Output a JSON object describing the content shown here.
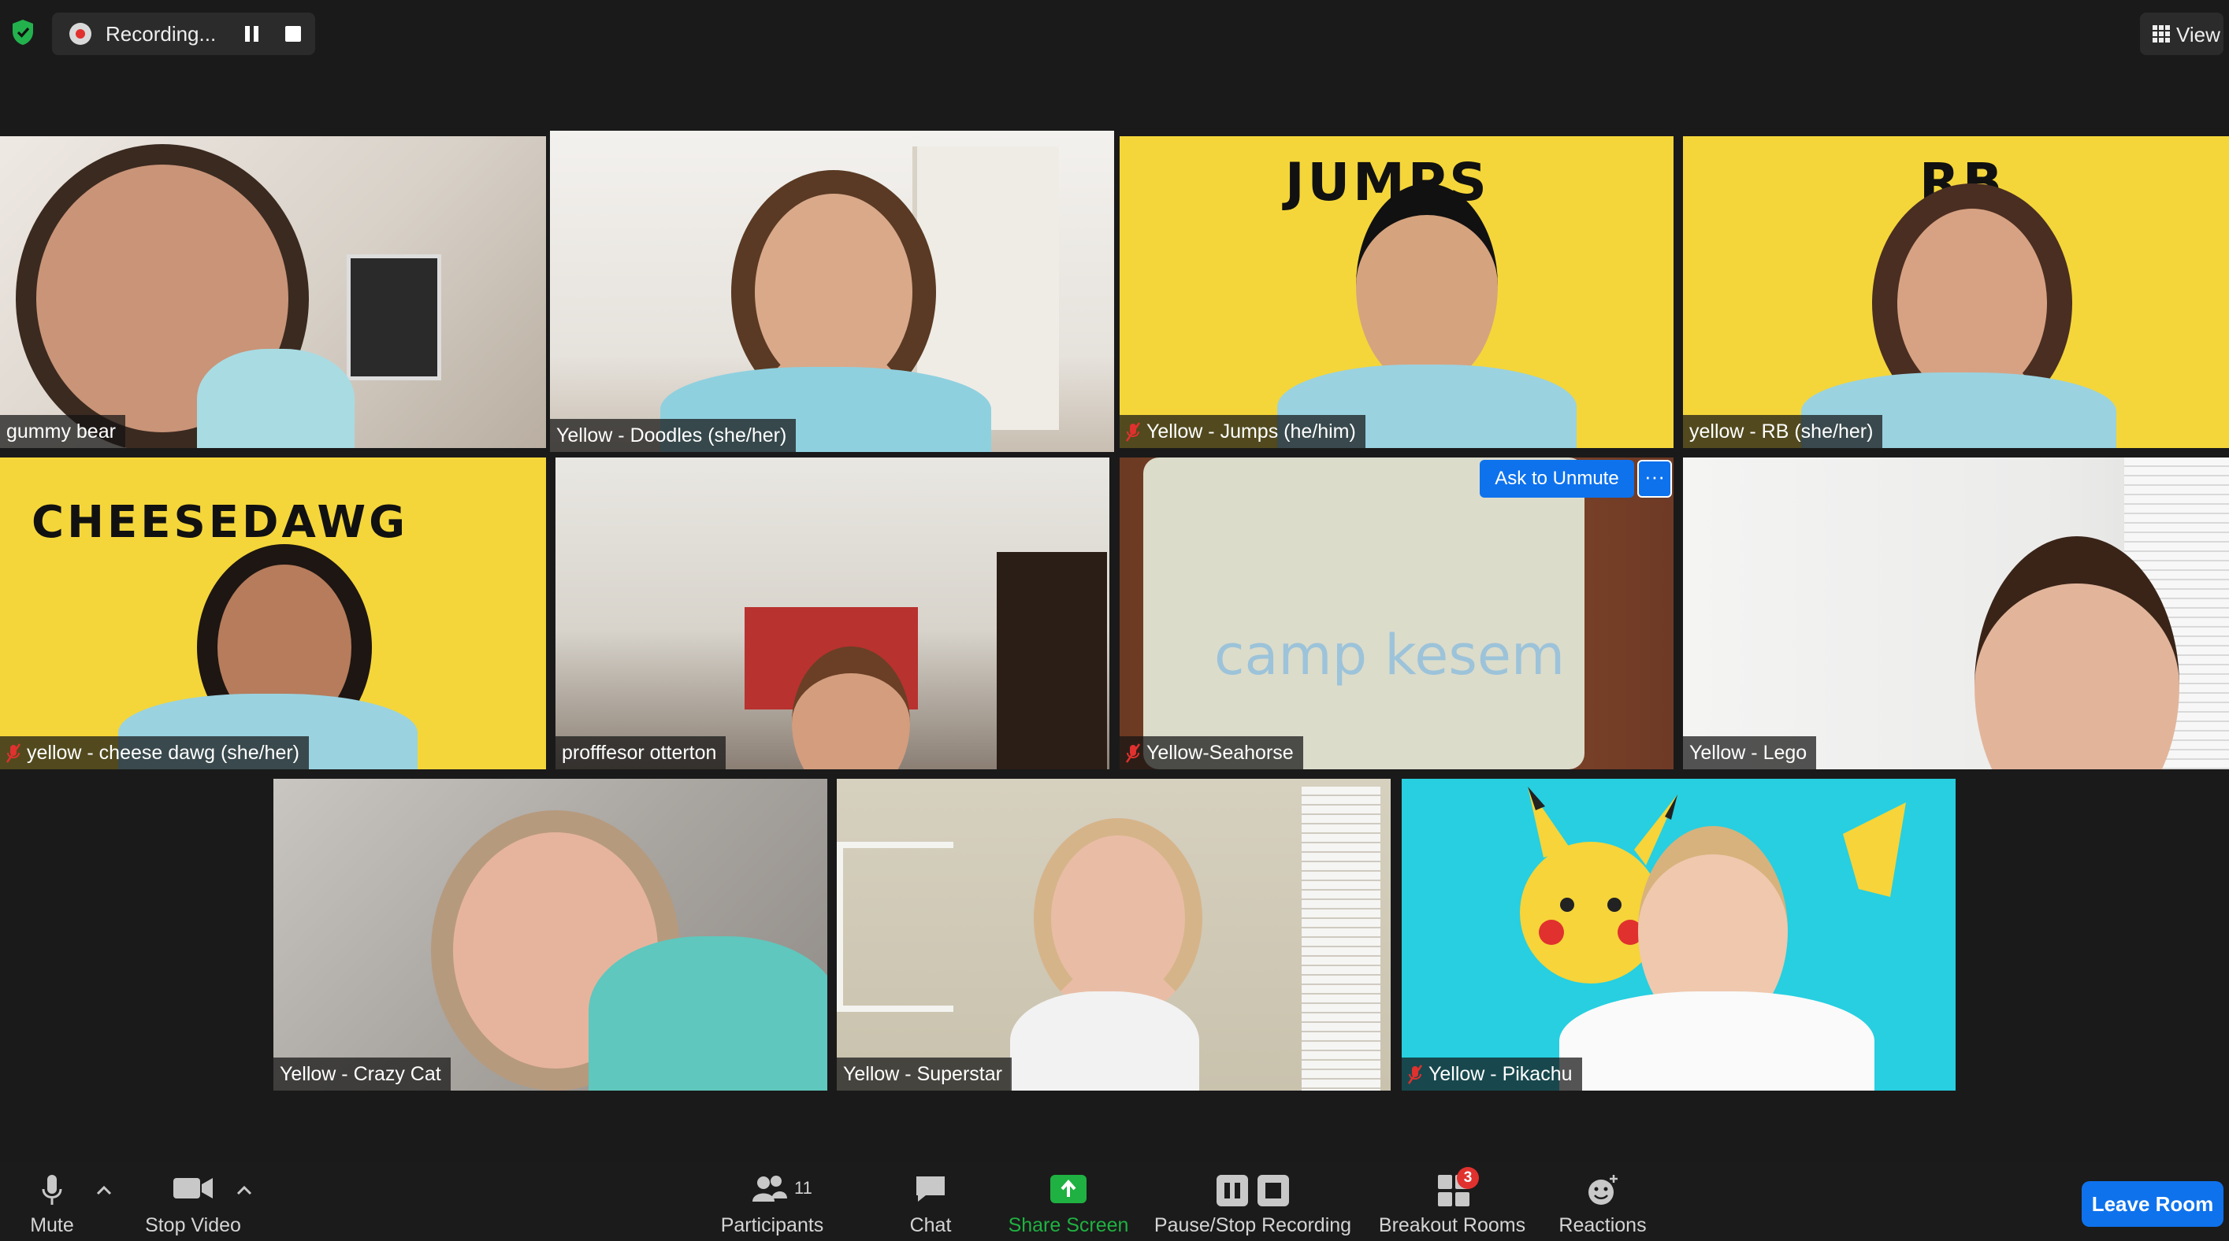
{
  "recording": {
    "label": "Recording..."
  },
  "view": {
    "label": "View"
  },
  "participants_tiles": [
    {
      "name": "gummy bear",
      "muted": false
    },
    {
      "name": "Yellow - Doodles (she/her)",
      "muted": false,
      "active_speaker": true
    },
    {
      "name": "Yellow - Jumps (he/him)",
      "muted": true,
      "background_text": "JUMPS"
    },
    {
      "name": "yellow - RB (she/her)",
      "muted": false,
      "background_text": "RB"
    },
    {
      "name": "yellow - cheese dawg (she/her)",
      "muted": true,
      "background_text": "CHEESEDAWG"
    },
    {
      "name": "profffesor otterton",
      "muted": false
    },
    {
      "name": "Yellow-Seahorse",
      "muted": true,
      "shirt_text": "camp kesem"
    },
    {
      "name": "Yellow - Lego",
      "muted": false
    },
    {
      "name": "Yellow - Crazy Cat",
      "muted": false
    },
    {
      "name": "Yellow - Superstar",
      "muted": false
    },
    {
      "name": "Yellow - Pikachu",
      "muted": true
    }
  ],
  "ask_unmute": {
    "label": "Ask to Unmute",
    "more": "···"
  },
  "toolbar": {
    "mute": "Mute",
    "stop_video": "Stop Video",
    "participants": "Participants",
    "participants_count": "11",
    "chat": "Chat",
    "share_screen": "Share Screen",
    "pause_stop_recording": "Pause/Stop Recording",
    "breakout_rooms": "Breakout Rooms",
    "breakout_badge": "3",
    "reactions": "Reactions",
    "leave": "Leave Room"
  },
  "colors": {
    "accent_blue": "#0e72ed",
    "share_green": "#1fb141",
    "speaker_border": "#c9e36d",
    "mute_red": "#e0312e",
    "background_yellow": "#f4d63a"
  }
}
